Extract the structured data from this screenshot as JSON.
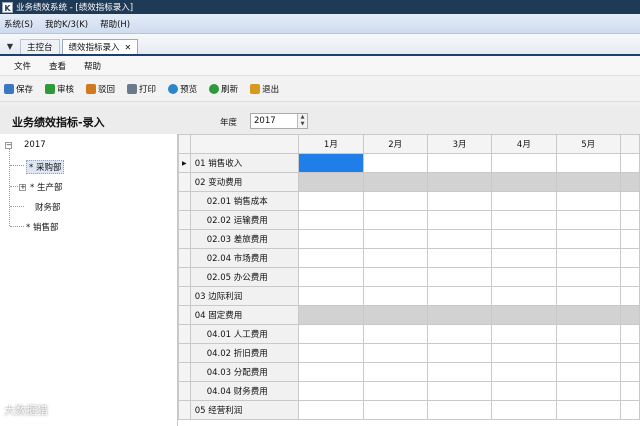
{
  "window": {
    "title": "业务绩效系统 - [绩效指标录入]"
  },
  "menubar": {
    "items": [
      "系统(S)",
      "我的K/3(K)",
      "帮助(H)"
    ]
  },
  "tabs": [
    {
      "label": "主控台",
      "active": false
    },
    {
      "label": "绩效指标录入",
      "active": true
    }
  ],
  "submenu": {
    "items": [
      "文件",
      "查看",
      "帮助"
    ]
  },
  "toolbar": {
    "buttons": [
      {
        "label": "保存",
        "icon": "save-icon",
        "color": "#3a78c3"
      },
      {
        "label": "审核",
        "icon": "approve-icon",
        "color": "#2f9a3a"
      },
      {
        "label": "驳回",
        "icon": "reject-icon",
        "color": "#d07a1e"
      },
      {
        "label": "打印",
        "icon": "print-icon",
        "color": "#6a7a8c"
      },
      {
        "label": "预览",
        "icon": "preview-icon",
        "color": "#2c86c9"
      },
      {
        "label": "刷新",
        "icon": "refresh-icon",
        "color": "#2f9a3a"
      },
      {
        "label": "退出",
        "icon": "exit-icon",
        "color": "#d89a1c"
      }
    ]
  },
  "form": {
    "title": "业务绩效指标-录入",
    "year_label": "年度",
    "year_value": "2017"
  },
  "tree": {
    "root": "2017",
    "nodes": [
      {
        "label": "* 采购部",
        "selected": true,
        "expandable": false
      },
      {
        "label": "* 生产部",
        "selected": false,
        "expandable": true
      },
      {
        "label": "财务部",
        "selected": false,
        "expandable": false
      },
      {
        "label": "* 销售部",
        "selected": false,
        "expandable": false
      }
    ]
  },
  "grid": {
    "columns": [
      "1月",
      "2月",
      "3月",
      "4月",
      "5月"
    ],
    "rows": [
      {
        "label": "01  销售收入",
        "sub": false,
        "gray": false,
        "current": true
      },
      {
        "label": "02  变动费用",
        "sub": false,
        "gray": true,
        "current": false
      },
      {
        "label": "02.01  销售成本",
        "sub": true,
        "gray": false,
        "current": false
      },
      {
        "label": "02.02  运输费用",
        "sub": true,
        "gray": false,
        "current": false
      },
      {
        "label": "02.03  差旅费用",
        "sub": true,
        "gray": false,
        "current": false
      },
      {
        "label": "02.04  市场费用",
        "sub": true,
        "gray": false,
        "current": false
      },
      {
        "label": "02.05  办公费用",
        "sub": true,
        "gray": false,
        "current": false
      },
      {
        "label": "03  边际利润",
        "sub": false,
        "gray": false,
        "current": false
      },
      {
        "label": "04  固定费用",
        "sub": false,
        "gray": true,
        "current": false
      },
      {
        "label": "04.01  人工费用",
        "sub": true,
        "gray": false,
        "current": false
      },
      {
        "label": "04.02  折旧费用",
        "sub": true,
        "gray": false,
        "current": false
      },
      {
        "label": "04.03  分配费用",
        "sub": true,
        "gray": false,
        "current": false
      },
      {
        "label": "04.04  财务费用",
        "sub": true,
        "gray": false,
        "current": false
      },
      {
        "label": "05  经营利润",
        "sub": false,
        "gray": false,
        "current": false
      }
    ]
  },
  "watermark": "大数据猎"
}
